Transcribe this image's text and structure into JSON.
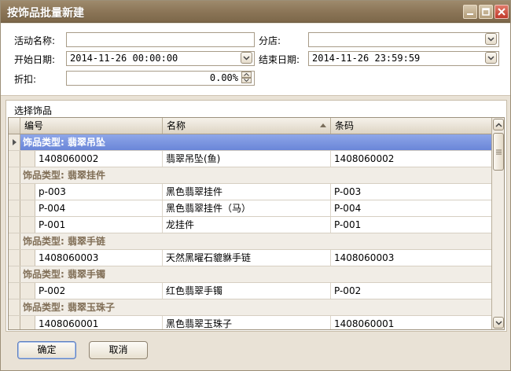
{
  "window": {
    "title": "按饰品批量新建"
  },
  "form": {
    "activity_label": "活动名称:",
    "activity_value": "",
    "branch_label": "分店:",
    "branch_value": "",
    "start_label": "开始日期:",
    "start_value": "2014-11-26 00:00:00",
    "end_label": "结束日期:",
    "end_value": "2014-11-26 23:59:59",
    "discount_label": "折扣:",
    "discount_value": "0.00%"
  },
  "grid": {
    "caption": "选择饰品",
    "columns": [
      "编号",
      "名称",
      "条码"
    ],
    "rows": [
      {
        "type": "group",
        "label": "饰品类型: 翡翠吊坠",
        "selected": true
      },
      {
        "type": "item",
        "id": "1408060002",
        "name": "翡翠吊坠(鱼)",
        "barcode": "1408060002"
      },
      {
        "type": "group",
        "label": "饰品类型: 翡翠挂件"
      },
      {
        "type": "item",
        "id": "p-003",
        "name": "黑色翡翠挂件",
        "barcode": "P-003"
      },
      {
        "type": "item",
        "id": "P-004",
        "name": "黑色翡翠挂件（马）",
        "barcode": "P-004"
      },
      {
        "type": "item",
        "id": "P-001",
        "name": "龙挂件",
        "barcode": "P-001"
      },
      {
        "type": "group",
        "label": "饰品类型: 翡翠手链"
      },
      {
        "type": "item",
        "id": "1408060003",
        "name": "天然黑曜石貔貅手链",
        "barcode": "1408060003"
      },
      {
        "type": "group",
        "label": "饰品类型: 翡翠手镯"
      },
      {
        "type": "item",
        "id": "P-002",
        "name": "红色翡翠手镯",
        "barcode": "P-002"
      },
      {
        "type": "group",
        "label": "饰品类型: 翡翠玉珠子"
      },
      {
        "type": "item",
        "id": "1408060001",
        "name": "黑色翡翠玉珠子",
        "barcode": "1408060001"
      }
    ]
  },
  "buttons": {
    "ok": "确定",
    "cancel": "取消"
  },
  "colors": {
    "titlebar": "#8a7456",
    "selected_row": "#7b95e0",
    "group_text": "#806e56"
  }
}
